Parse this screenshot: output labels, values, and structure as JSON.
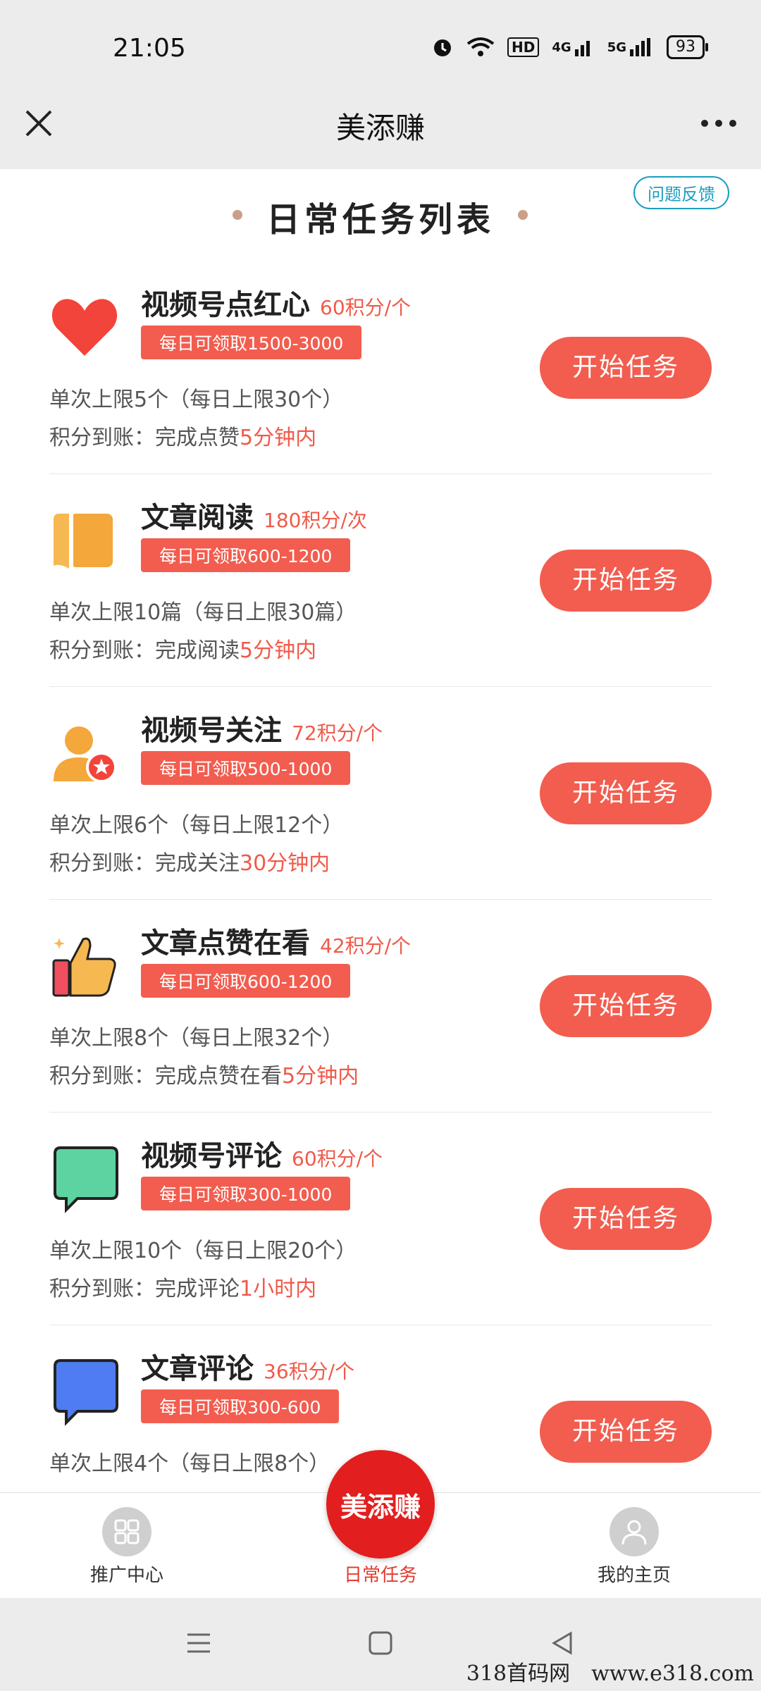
{
  "status": {
    "time": "21:05",
    "battery": "93",
    "network_labels": [
      "HD",
      "4G",
      "5G"
    ]
  },
  "nav": {
    "title": "美添赚"
  },
  "feedback": "问题反馈",
  "list_title": "日常任务列表",
  "tasks": [
    {
      "name": "视频号点红心",
      "points": "60积分/个",
      "daily": "每日可领取1500-3000",
      "limit": "单次上限5个（每日上限30个）",
      "arrive_prefix": "积分到账：完成点赞",
      "arrive_time": "5分钟内",
      "button": "开始任务",
      "icon": "heart-icon"
    },
    {
      "name": "文章阅读",
      "points": "180积分/次",
      "daily": "每日可领取600-1200",
      "limit": "单次上限10篇（每日上限30篇）",
      "arrive_prefix": "积分到账：完成阅读",
      "arrive_time": "5分钟内",
      "button": "开始任务",
      "icon": "book-icon"
    },
    {
      "name": "视频号关注",
      "points": "72积分/个",
      "daily": "每日可领取500-1000",
      "limit": "单次上限6个（每日上限12个）",
      "arrive_prefix": "积分到账：完成关注",
      "arrive_time": "30分钟内",
      "button": "开始任务",
      "icon": "user-star-icon"
    },
    {
      "name": "文章点赞在看",
      "points": "42积分/个",
      "daily": "每日可领取600-1200",
      "limit": "单次上限8个（每日上限32个）",
      "arrive_prefix": "积分到账：完成点赞在看",
      "arrive_time": "5分钟内",
      "button": "开始任务",
      "icon": "thumbs-up-icon"
    },
    {
      "name": "视频号评论",
      "points": "60积分/个",
      "daily": "每日可领取300-1000",
      "limit": "单次上限10个（每日上限20个）",
      "arrive_prefix": "积分到账：完成评论",
      "arrive_time": "1小时内",
      "button": "开始任务",
      "icon": "green-comment-icon"
    },
    {
      "name": "文章评论",
      "points": "36积分/个",
      "daily": "每日可领取300-600",
      "limit": "单次上限4个（每日上限8个）",
      "arrive_prefix": "",
      "arrive_time": "",
      "button": "开始任务",
      "icon": "blue-comment-icon"
    }
  ],
  "tabs": {
    "promo": "推广中心",
    "daily": "日常任务",
    "home": "我的主页"
  },
  "logo_text": "美添赚",
  "watermark": "318首码网　www.e318.com"
}
